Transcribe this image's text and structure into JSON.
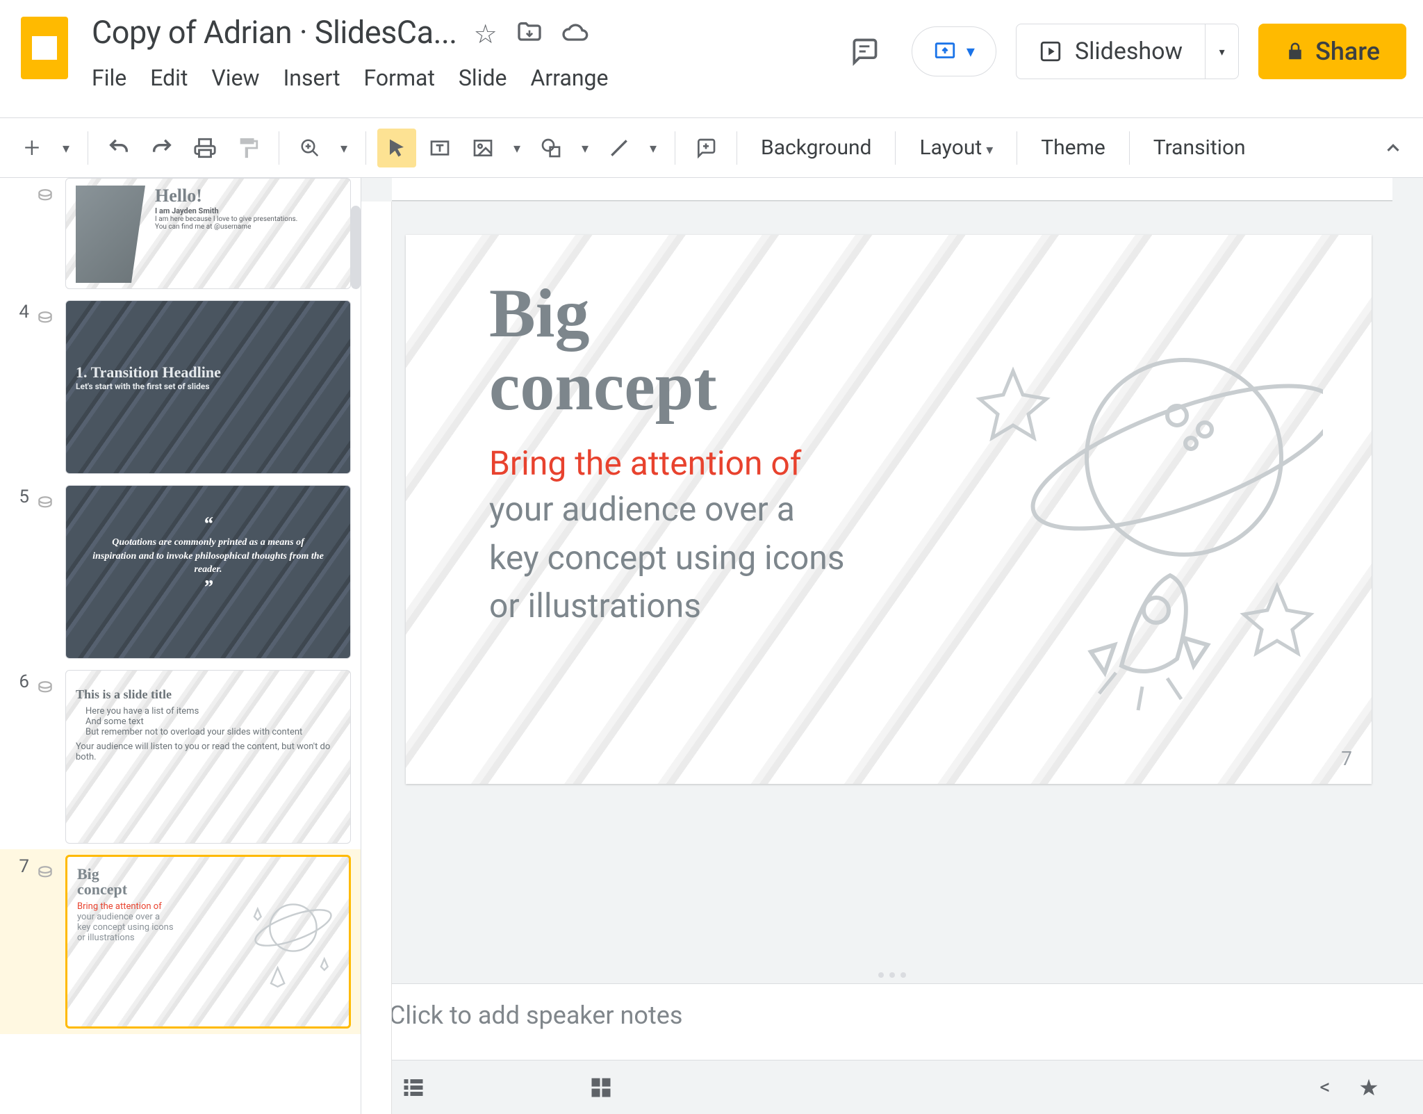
{
  "header": {
    "doc_title": "Copy of Adrian · SlidesCa...",
    "menus": [
      "File",
      "Edit",
      "View",
      "Insert",
      "Format",
      "Slide",
      "Arrange"
    ],
    "slideshow_label": "Slideshow",
    "share_label": "Share"
  },
  "toolbar": {
    "background": "Background",
    "layout": "Layout",
    "theme": "Theme",
    "transition": "Transition"
  },
  "filmstrip": {
    "visible_numbers": [
      "",
      "4",
      "5",
      "6",
      "7"
    ],
    "slides": [
      {
        "title": "Hello!",
        "sub1": "I am Jayden Smith",
        "sub2": "I am here because I love to give presentations.",
        "sub3": "You can find me at @username"
      },
      {
        "title": "1. Transition Headline",
        "sub1": "Let's start with the first set of slides"
      },
      {
        "quote": "Quotations are commonly printed as a means of inspiration and to invoke philosophical thoughts from the reader."
      },
      {
        "title": "This is a slide title",
        "b1": "Here you have a list of items",
        "b2": "And some text",
        "b3": "But remember not to overload your slides with content",
        "b4": "Your audience will listen to you or read the content, but won't do both."
      },
      {
        "title_l1": "Big",
        "title_l2": "concept",
        "red": "Bring the attention of",
        "g1": "your audience over a",
        "g2": "key concept using icons",
        "g3": "or illustrations"
      }
    ]
  },
  "current_slide": {
    "number": "7",
    "title_line1": "Big",
    "title_line2": "concept",
    "red_text": "Bring the attention of",
    "gray_line1": "your audience over a",
    "gray_line2": "key concept using icons",
    "gray_line3": "or illustrations",
    "page_number": "7"
  },
  "notes": {
    "placeholder": "Click to add speaker notes"
  }
}
